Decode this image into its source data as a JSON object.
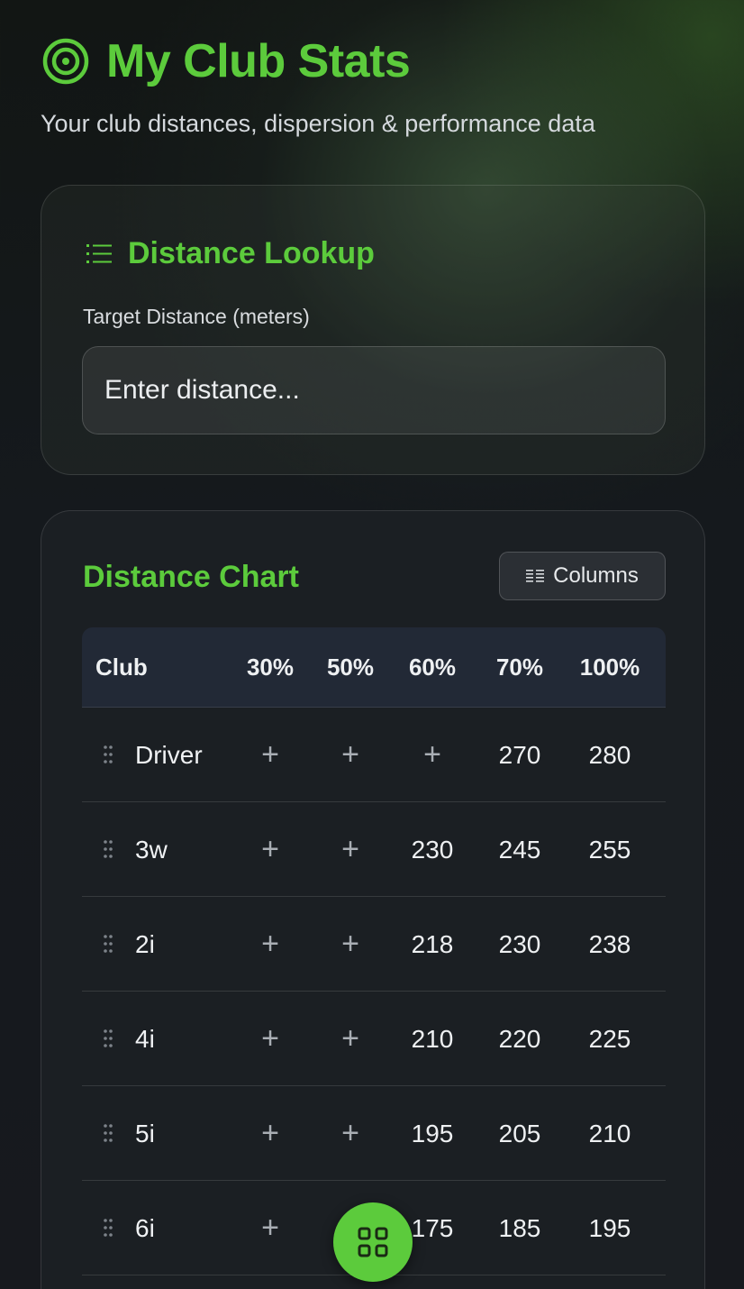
{
  "header": {
    "title": "My Club Stats",
    "subtitle": "Your club distances, dispersion & performance data",
    "icon": "target-icon"
  },
  "lookup": {
    "title": "Distance Lookup",
    "icon": "list-icon",
    "field_label": "Target Distance (meters)",
    "placeholder": "Enter distance..."
  },
  "chart": {
    "title": "Distance Chart",
    "columns_button": "Columns",
    "columns_icon": "columns-icon",
    "headers": [
      "Club",
      "30%",
      "50%",
      "60%",
      "70%",
      "100%"
    ],
    "rows": [
      {
        "club": "Driver",
        "v30": "+",
        "v50": "+",
        "v60": "+",
        "v70": "270",
        "v100": "280"
      },
      {
        "club": "3w",
        "v30": "+",
        "v50": "+",
        "v60": "230",
        "v70": "245",
        "v100": "255"
      },
      {
        "club": "2i",
        "v30": "+",
        "v50": "+",
        "v60": "218",
        "v70": "230",
        "v100": "238"
      },
      {
        "club": "4i",
        "v30": "+",
        "v50": "+",
        "v60": "210",
        "v70": "220",
        "v100": "225"
      },
      {
        "club": "5i",
        "v30": "+",
        "v50": "+",
        "v60": "195",
        "v70": "205",
        "v100": "210"
      },
      {
        "club": "6i",
        "v30": "+",
        "v50": "+",
        "v60": "175",
        "v70": "185",
        "v100": "195"
      }
    ]
  },
  "fab": {
    "icon": "grid-menu-icon"
  },
  "colors": {
    "accent": "#5ccb3c",
    "background": "#15191d"
  }
}
